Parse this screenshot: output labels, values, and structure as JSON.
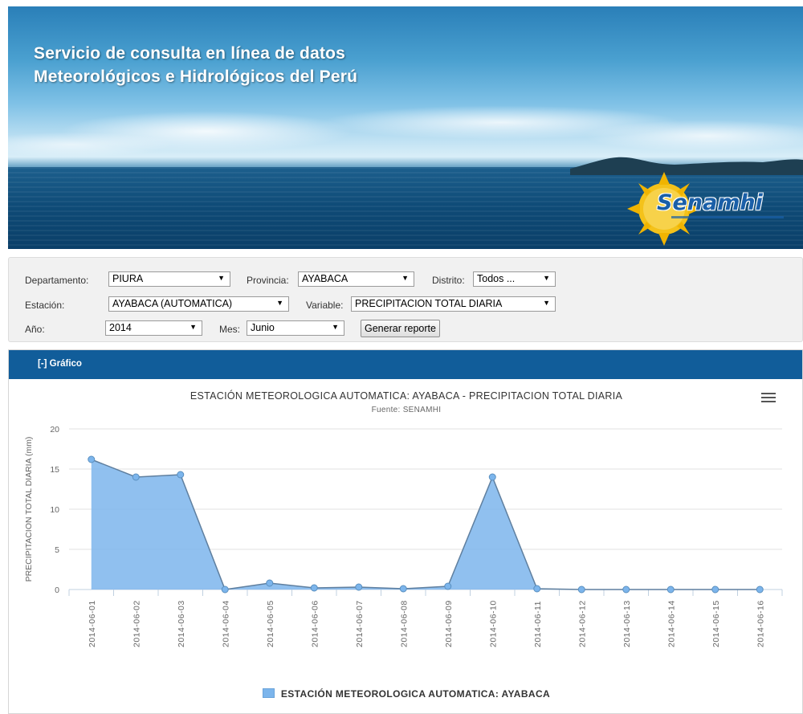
{
  "banner": {
    "title_line1": "Servicio de consulta en línea de datos",
    "title_line2": "Meteorológicos e Hidrológicos del Perú",
    "logo_text": "Senamhi"
  },
  "filters": {
    "departamento_label": "Departamento:",
    "departamento_value": "PIURA",
    "provincia_label": "Provincia:",
    "provincia_value": "AYABACA",
    "distrito_label": "Distrito:",
    "distrito_value": "Todos ...",
    "estacion_label": "Estación:",
    "estacion_value": "AYABACA (AUTOMATICA)",
    "variable_label": "Variable:",
    "variable_value": "PRECIPITACION TOTAL DIARIA",
    "anio_label": "Año:",
    "anio_value": "2014",
    "mes_label": "Mes:",
    "mes_value": "Junio",
    "generate_button": "Generar reporte"
  },
  "panel": {
    "header": "[-] Gráfico"
  },
  "chart_data": {
    "type": "area",
    "title": "ESTACIÓN METEOROLOGICA AUTOMATICA: AYABACA - PRECIPITACION TOTAL DIARIA",
    "subtitle": "Fuente: SENAMHI",
    "ylabel": "PRECIPITACION TOTAL DIARIA (mm)",
    "xlabel": "",
    "ylim": [
      0,
      20
    ],
    "yticks": [
      0,
      5,
      10,
      15,
      20
    ],
    "grid": true,
    "legend_position": "bottom",
    "categories": [
      "2014-06-01",
      "2014-06-02",
      "2014-06-03",
      "2014-06-04",
      "2014-06-05",
      "2014-06-06",
      "2014-06-07",
      "2014-06-08",
      "2014-06-09",
      "2014-06-10",
      "2014-06-11",
      "2014-06-12",
      "2014-06-13",
      "2014-06-14",
      "2014-06-15",
      "2014-06-16"
    ],
    "series": [
      {
        "name": "ESTACIÓN METEOROLOGICA AUTOMATICA: AYABACA",
        "color": "#7cb5ec",
        "values": [
          16.2,
          14.0,
          14.3,
          0.0,
          0.8,
          0.2,
          0.3,
          0.1,
          0.4,
          14.0,
          0.1,
          0.0,
          0.0,
          0.0,
          0.0,
          0.0
        ]
      }
    ]
  }
}
